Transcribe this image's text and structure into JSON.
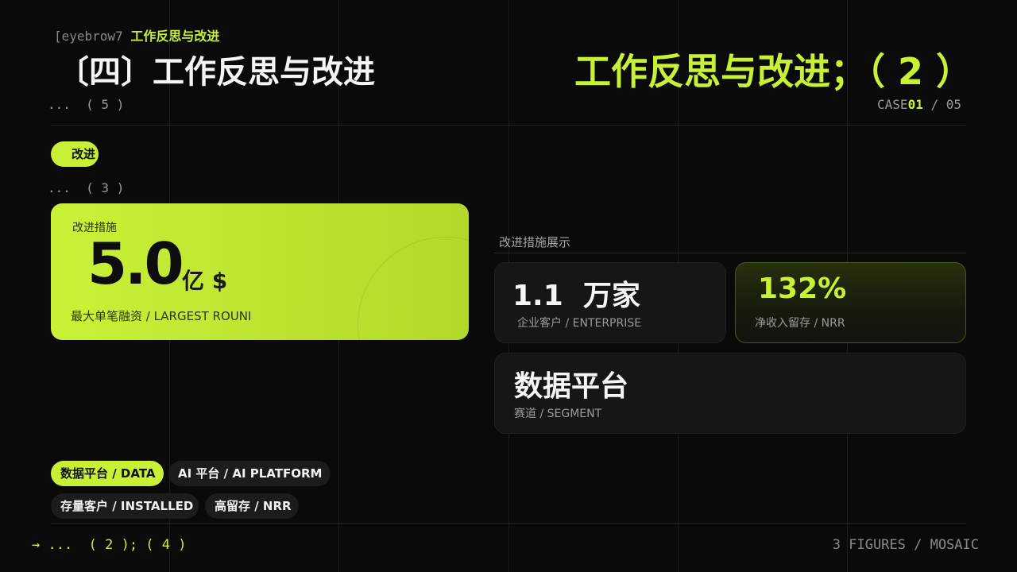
{
  "eyebrow": {
    "code": "[eyebrow7",
    "text": "工作反思与改进"
  },
  "title": {
    "left": "〔四〕工作反思与改进",
    "right": "工作反思与改进；（ 2 ）"
  },
  "sub": {
    "left": "...  ( 5 )",
    "case_prefix": "CASE",
    "case_num": "01",
    "case_total": " / 05"
  },
  "tag": "改进",
  "sub2": "...  ( 3 )",
  "hero": {
    "label": "改进措施",
    "value": "5.0",
    "unit": "亿 $",
    "caption": "最大单笔融资 / LARGEST ROUNI"
  },
  "section": {
    "label": "改进措施展示"
  },
  "cards": [
    {
      "value": "1.1  万家",
      "label": "企业客户 / ENTERPRISE"
    },
    {
      "value": "132%",
      "label": "净收入留存 / NRR"
    },
    {
      "value": "数据平台",
      "label": "赛道 / SEGMENT"
    }
  ],
  "chips": [
    {
      "label": "数据平台 / DATA"
    },
    {
      "label": "AI 平台 / AI PLATFORM"
    },
    {
      "label": "存量客户 / INSTALLED"
    },
    {
      "label": "高留存 / NRR"
    }
  ],
  "footer": {
    "left": "→ ...  ( 2 ); ( 4 )",
    "right": "3 FIGURES / MOSAIC"
  },
  "colors": {
    "accent": "#c8f135",
    "background": "#0a0a0a"
  }
}
